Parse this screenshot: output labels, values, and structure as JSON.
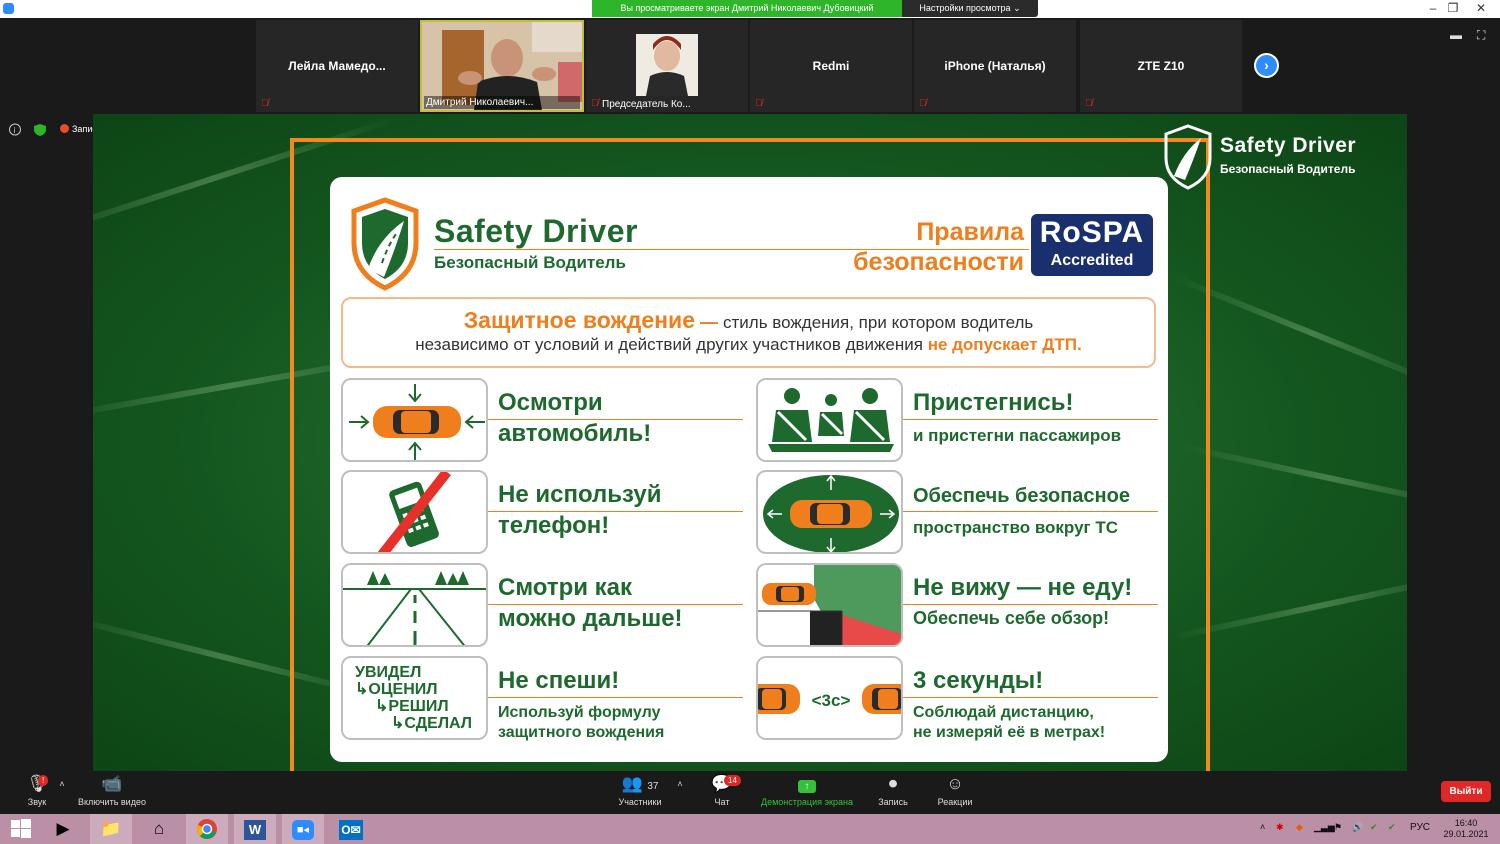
{
  "window": {
    "share_banner": "Вы просматриваете экран Дмитрий Николаевич Дубовицкий",
    "view_settings": "Настройки просмотра",
    "minimize": "–",
    "restore": "❐",
    "close": "✕"
  },
  "participants": [
    {
      "name": "Лейла  Мамедо...",
      "muted": true,
      "video": false
    },
    {
      "name": "Дмитрий Николаевич...",
      "muted": false,
      "video": true
    },
    {
      "name": "Председатель Ко...",
      "muted": true,
      "video": true
    },
    {
      "name": "Redmi",
      "muted": true,
      "video": false
    },
    {
      "name": "iPhone (Наталья)",
      "muted": true,
      "video": false
    },
    {
      "name": "ZTE Z10",
      "muted": true,
      "video": false
    }
  ],
  "status": {
    "recording_label": "Запись"
  },
  "slide": {
    "corner_logo_title": "Safety Driver",
    "corner_logo_subtitle": "Безопасный Водитель",
    "brand_title": "Safety Driver",
    "brand_subtitle": "Безопасный Водитель",
    "rules_line1": "Правила",
    "rules_line2": "безопасности",
    "rospa_name": "RoSPA",
    "rospa_accredited": "Accredited",
    "definition_term": "Защитное вождение",
    "definition_dash": " — ",
    "definition_text1": "стиль вождения, при котором водитель",
    "definition_text2": "независимо от условий и действий других участников движения ",
    "definition_accent": "не допускает ДТП.",
    "rules": [
      {
        "line1": "Осмотри",
        "line2": "автомобиль!"
      },
      {
        "line1": "Пристегнись!",
        "sub1": "и пристегни пассажиров"
      },
      {
        "line1": "Не используй",
        "line2": "телефон!"
      },
      {
        "sub_big1": "Обеспечь безопасное",
        "sub2": "пространство вокруг ТС"
      },
      {
        "line1": "Смотри как",
        "line2": "можно дальше!"
      },
      {
        "line1": "Не вижу — не еду!",
        "sub1": "Обеспечь себе обзор!"
      },
      {
        "line1": "Не спеши!",
        "sub1": "Используй формулу",
        "sub2": "защитного вождения",
        "formula": [
          "УВИДЕЛ",
          "↳ОЦЕНИЛ",
          "↳РЕШИЛ",
          "↳СДЕЛАЛ"
        ]
      },
      {
        "line1": "3 секунды!",
        "sub1": "Соблюдай дистанцию,",
        "sub2": "не измеряй её в метрах!",
        "gap_label": "<3с>"
      }
    ]
  },
  "toolbar": {
    "audio": "Звук",
    "video": "Включить видео",
    "participants": "Участники",
    "participants_count": "37",
    "chat": "Чат",
    "chat_badge": "14",
    "share": "Демонстрация экрана",
    "record": "Запись",
    "reactions": "Реакции",
    "leave": "Выйти"
  },
  "taskbar": {
    "language": "РУС",
    "time": "16:40",
    "date": "29.01.2021"
  },
  "colors": {
    "accent": "#ef7e1d",
    "brand_green": "#1e6a2e",
    "zoom_blue": "#2d8cff",
    "leave_red": "#e02828"
  }
}
